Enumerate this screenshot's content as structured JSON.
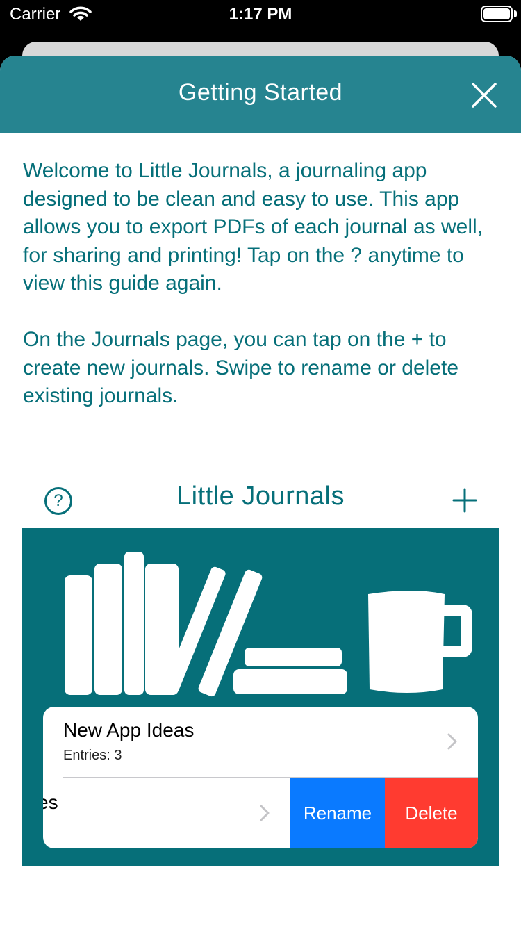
{
  "status_bar": {
    "carrier": "Carrier",
    "time": "1:17 PM"
  },
  "sheet": {
    "title": "Getting Started",
    "paragraphs": [
      "Welcome to Little Journals, a journaling app designed to be clean and easy to use. This app allows you to export PDFs of each journal as well, for sharing and printing! Tap on the ? anytime to view this guide again.",
      "On the Journals page, you can tap on the + to create new journals. Swipe to rename or delete existing journals."
    ]
  },
  "preview": {
    "nav_title": "Little Journals",
    "help_label": "?",
    "rows": [
      {
        "title": "New App Ideas",
        "subtitle": "Entries: 3"
      },
      {
        "title_partial": "es"
      }
    ],
    "actions": {
      "rename": "Rename",
      "delete": "Delete"
    }
  },
  "colors": {
    "header_teal": "#268490",
    "text_teal": "#066f79",
    "rename_blue": "#0a7aff",
    "delete_red": "#ff3b30"
  }
}
